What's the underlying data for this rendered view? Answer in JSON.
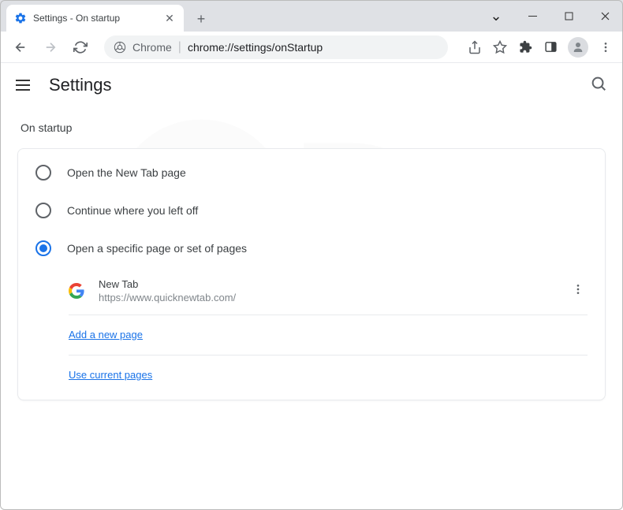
{
  "tab": {
    "title": "Settings - On startup"
  },
  "address": {
    "prefix": "Chrome",
    "path": "chrome://settings/onStartup"
  },
  "settings": {
    "title": "Settings",
    "section_title": "On startup",
    "options": {
      "new_tab": "Open the New Tab page",
      "continue": "Continue where you left off",
      "specific": "Open a specific page or set of pages"
    },
    "pages": [
      {
        "title": "New Tab",
        "url": "https://www.quicknewtab.com/"
      }
    ],
    "add_page": "Add a new page",
    "use_current": "Use current pages"
  }
}
